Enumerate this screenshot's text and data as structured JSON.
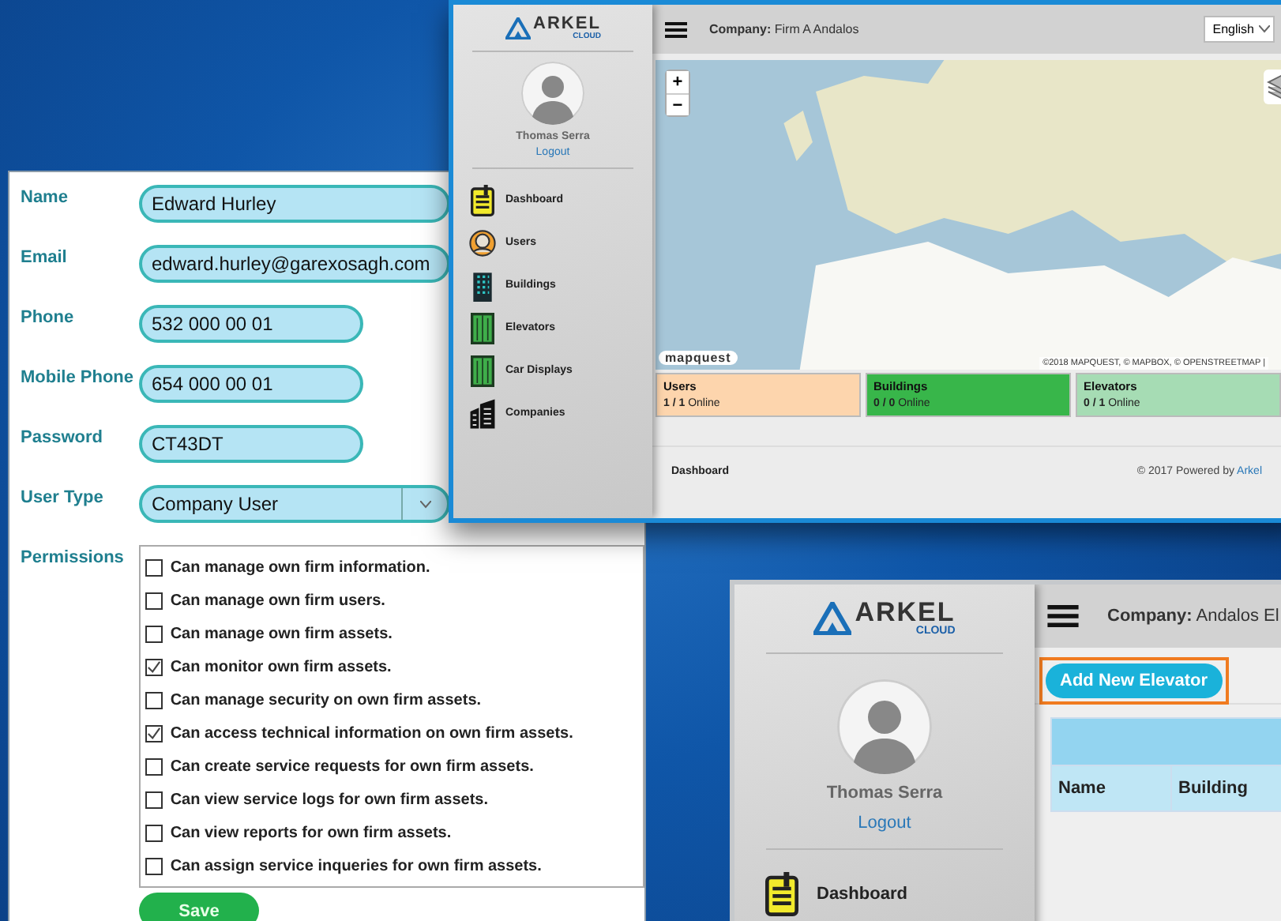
{
  "user_form": {
    "fields": [
      {
        "label": "Name",
        "value": "Edward Hurley",
        "kind": "text",
        "wide": true
      },
      {
        "label": "Email",
        "value": "edward.hurley@garexosagh.com",
        "kind": "text",
        "wide": true
      },
      {
        "label": "Phone",
        "value": "532 000 00 01",
        "kind": "text",
        "wide": false
      },
      {
        "label": "Mobile Phone",
        "value": "654 000 00 01",
        "kind": "text",
        "wide": false
      },
      {
        "label": "Password",
        "value": "CT43DT",
        "kind": "text",
        "wide": false
      },
      {
        "label": "User Type",
        "value": "Company User",
        "kind": "select",
        "wide": true
      }
    ],
    "permissions_label": "Permissions",
    "permissions": [
      {
        "label": "Can manage own firm information.",
        "checked": false
      },
      {
        "label": "Can manage own firm users.",
        "checked": false
      },
      {
        "label": "Can manage own firm assets.",
        "checked": false
      },
      {
        "label": "Can monitor own firm assets.",
        "checked": true
      },
      {
        "label": "Can manage security on own firm assets.",
        "checked": false
      },
      {
        "label": "Can access technical information on own firm assets.",
        "checked": true
      },
      {
        "label": "Can create service requests for own firm assets.",
        "checked": false
      },
      {
        "label": "Can view service logs for own firm assets.",
        "checked": false
      },
      {
        "label": "Can view reports for own firm assets.",
        "checked": false
      },
      {
        "label": "Can assign service inqueries for own firm assets.",
        "checked": false
      }
    ],
    "save_button": "Save"
  },
  "dashboard_window": {
    "logo": {
      "name": "ARKEL",
      "tagline": "CLOUD"
    },
    "user": {
      "name": "Thomas Serra",
      "logout": "Logout"
    },
    "nav": [
      {
        "label": "Dashboard",
        "kind": "clipboard"
      },
      {
        "label": "Users",
        "kind": "person"
      },
      {
        "label": "Buildings",
        "kind": "building"
      },
      {
        "label": "Elevators",
        "kind": "elevator"
      },
      {
        "label": "Car Displays",
        "kind": "elevator"
      },
      {
        "label": "Companies",
        "kind": "companies"
      }
    ],
    "topbar": {
      "company_label": "Company:",
      "company_value": "Firm A Andalos",
      "language": "English"
    },
    "map": {
      "zoom_in": "+",
      "zoom_out": "−",
      "logo": "mapquest",
      "attribution": "©2018 MAPQUEST, © MAPBOX, © OPENSTREETMAP |"
    },
    "stats": [
      {
        "title": "Users",
        "count": "1 / 1",
        "status": "Online",
        "color": "#fdd5ad"
      },
      {
        "title": "Buildings",
        "count": "0 / 0",
        "status": "Online",
        "color": "#38b64a"
      },
      {
        "title": "Elevators",
        "count": "0 / 1",
        "status": "Online",
        "color": "#a6dcb4"
      }
    ],
    "footer": {
      "page": "Dashboard",
      "copyright": "© 2017 Powered by",
      "link": "Arkel"
    }
  },
  "elevators_window": {
    "logo": {
      "name": "ARKEL",
      "tagline": "CLOUD"
    },
    "user": {
      "name": "Thomas Serra",
      "logout": "Logout"
    },
    "nav": [
      {
        "label": "Dashboard",
        "kind": "clipboard"
      }
    ],
    "topbar": {
      "company_label": "Company:",
      "company_value": "Andalos El"
    },
    "add_button": "Add New Elevator",
    "table": {
      "columns": [
        "Name",
        "Building"
      ]
    }
  }
}
